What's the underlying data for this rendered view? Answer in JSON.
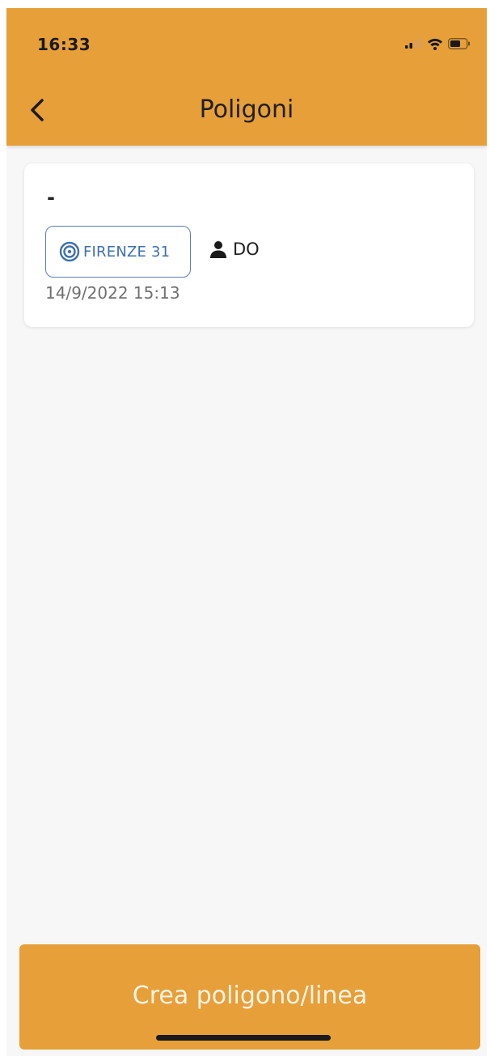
{
  "status_bar": {
    "time": "16:33",
    "icons": [
      "signal-icon",
      "wifi-icon",
      "battery-icon"
    ]
  },
  "header": {
    "title": "Poligoni",
    "back_icon": "chevron-left-icon"
  },
  "list": {
    "items": [
      {
        "title": "-",
        "tag_icon": "target-icon",
        "tag": "FIRENZE 31",
        "user_icon": "person-icon",
        "user": "DO",
        "date": "14/9/2022 15:13"
      }
    ]
  },
  "footer": {
    "create_label": "Crea poligono/linea"
  },
  "colors": {
    "accent": "#e69f39",
    "tag_blue": "#3e6fae",
    "background": "#f7f7f7"
  }
}
